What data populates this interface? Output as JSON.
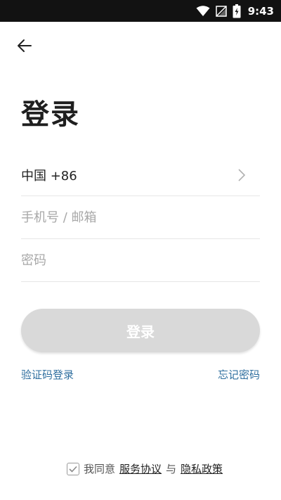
{
  "status_bar": {
    "time": "9:43",
    "icons": [
      "wifi-icon",
      "no-signal-icon",
      "battery-charging-icon"
    ]
  },
  "header": {
    "back_icon": "arrow-left-icon"
  },
  "title": "登录",
  "form": {
    "country": "中国 +86",
    "phone_placeholder": "手机号 / 邮箱",
    "password_placeholder": "密码"
  },
  "login_button_label": "登录",
  "links": {
    "sms_login": "验证码登录",
    "forgot_password": "忘记密码"
  },
  "agreement": {
    "checked": true,
    "prefix": "我同意",
    "terms": "服务协议",
    "and": "与",
    "privacy": "隐私政策"
  },
  "colors": {
    "status_bar_bg": "#121212",
    "link": "#2f6f9f",
    "button_disabled": "#d9d9d9"
  }
}
